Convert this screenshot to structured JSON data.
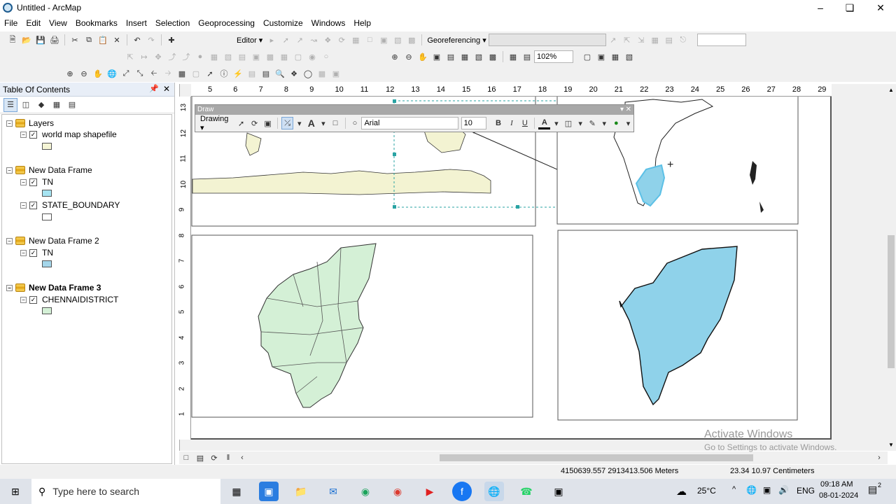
{
  "window": {
    "title": "Untitled - ArcMap"
  },
  "menu": [
    "File",
    "Edit",
    "View",
    "Bookmarks",
    "Insert",
    "Selection",
    "Geoprocessing",
    "Customize",
    "Windows",
    "Help"
  ],
  "toolbar": {
    "editor_label": "Editor ▾",
    "georef_label": "Georeferencing ▾",
    "zoom_value": "102%"
  },
  "toc": {
    "title": "Table Of Contents",
    "frames": [
      {
        "name": "Layers",
        "layers": [
          {
            "name": "world map shapefile",
            "color": "#f5f5d5"
          }
        ]
      },
      {
        "name": "New Data Frame",
        "layers": [
          {
            "name": "TN",
            "color": "#a6e4f2"
          },
          {
            "name": "STATE_BOUNDARY",
            "color": "#ffffff"
          }
        ]
      },
      {
        "name": "New Data Frame 2",
        "layers": [
          {
            "name": "TN",
            "color": "#a5d6ea"
          }
        ]
      },
      {
        "name": "New Data Frame 3",
        "layers": [
          {
            "name": "CHENNAIDISTRICT",
            "color": "#d4f0d6"
          }
        ]
      }
    ]
  },
  "ruler": {
    "h": [
      "5",
      "6",
      "7",
      "8",
      "9",
      "10",
      "11",
      "12",
      "13",
      "14",
      "15",
      "16",
      "17",
      "18",
      "19",
      "20",
      "21",
      "22",
      "23",
      "24",
      "25",
      "26",
      "27",
      "28",
      "29"
    ],
    "v": [
      "13",
      "12",
      "11",
      "10",
      "9",
      "8",
      "7",
      "6",
      "5",
      "4",
      "3",
      "2",
      "1"
    ]
  },
  "draw_toolbar": {
    "caption": "Draw",
    "drawing_label": "Drawing ▾",
    "font": "Arial",
    "size": "10",
    "bold": "B",
    "italic": "I",
    "underline": "U",
    "text_tool": "A"
  },
  "status": {
    "coords": "4150639.557  2913413.506 Meters",
    "page_coords": "23.34  10.97 Centimeters"
  },
  "watermark": {
    "line1": "Activate Windows",
    "line2": "Go to Settings to activate Windows."
  },
  "taskbar": {
    "search_placeholder": "Type here to search",
    "temp": "25°C",
    "lang": "ENG",
    "time": "09:18 AM",
    "date": "08-01-2024",
    "notif": "2"
  },
  "colors": {
    "tn": "#8fd2ea",
    "chennai": "#d4f0d6",
    "world": "#f3f3d2"
  }
}
